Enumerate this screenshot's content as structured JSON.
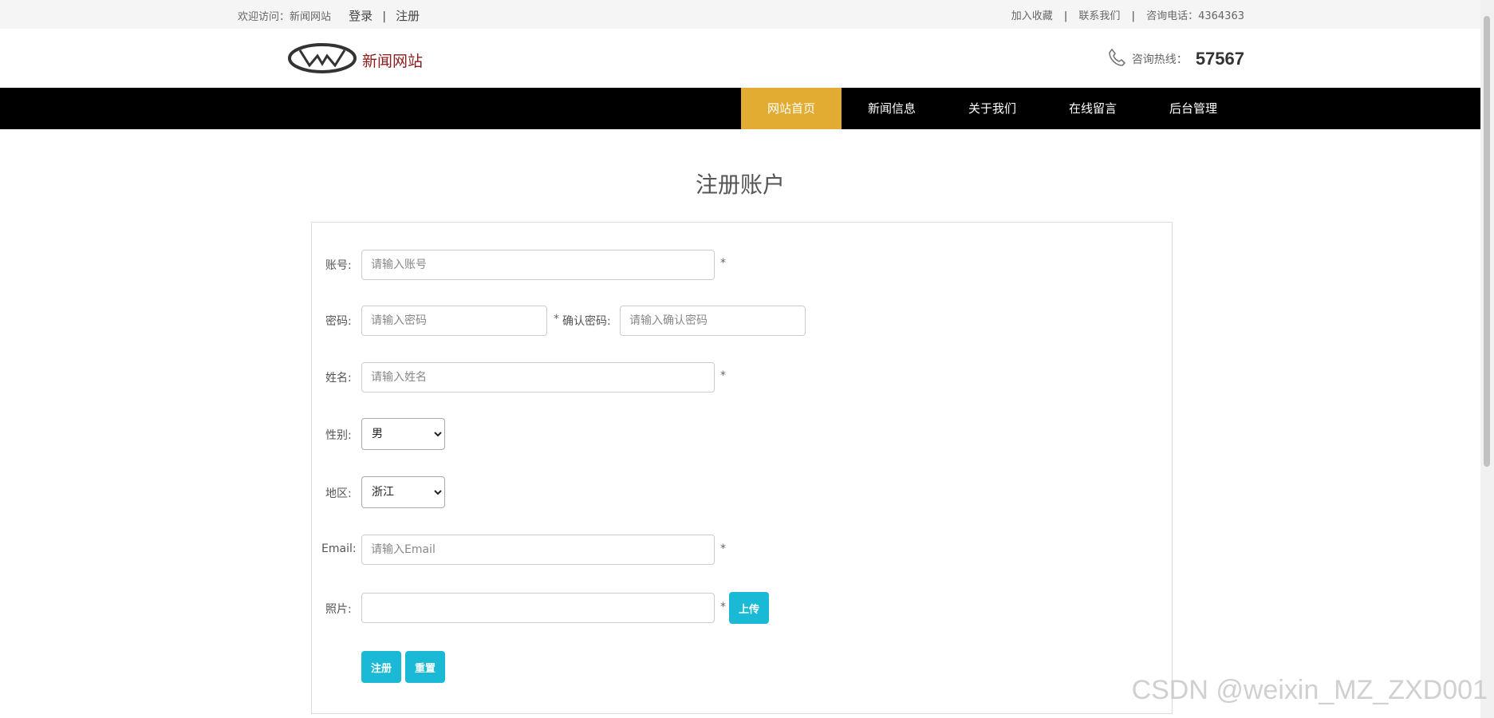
{
  "topbar": {
    "welcome": "欢迎访问：新闻网站",
    "login": "登录",
    "separator": "|",
    "register": "注册",
    "bookmark": "加入收藏",
    "contact": "联系我们",
    "phone": "咨询电话：4364363"
  },
  "header": {
    "site_name": "新闻网站",
    "hotline_label": "咨询热线：",
    "hotline_number": "57567"
  },
  "nav": {
    "items": [
      "网站首页",
      "新闻信息",
      "关于我们",
      "在线留言",
      "后台管理"
    ],
    "active_index": 0,
    "active_color": "#e2ac32"
  },
  "page": {
    "title": "注册账户"
  },
  "form": {
    "account": {
      "label": "账号:",
      "placeholder": "请输入账号",
      "required": "*"
    },
    "password": {
      "label": "密码:",
      "placeholder": "请输入密码",
      "required": "*"
    },
    "confirm_password": {
      "label": "确认密码:",
      "placeholder": "请输入确认密码"
    },
    "name": {
      "label": "姓名:",
      "placeholder": "请输入姓名",
      "required": "*"
    },
    "gender": {
      "label": "性别:",
      "selected": "男"
    },
    "region": {
      "label": "地区:",
      "selected": "浙江"
    },
    "email": {
      "label": "Email:",
      "placeholder": "请输入Email",
      "required": "*"
    },
    "photo": {
      "label": "照片:",
      "value": "",
      "required": "*",
      "upload_label": "上传"
    },
    "submit_label": "注册",
    "reset_label": "重置",
    "button_color": "#1ab9d5"
  },
  "watermark": "CSDN @weixin_MZ_ZXD001"
}
